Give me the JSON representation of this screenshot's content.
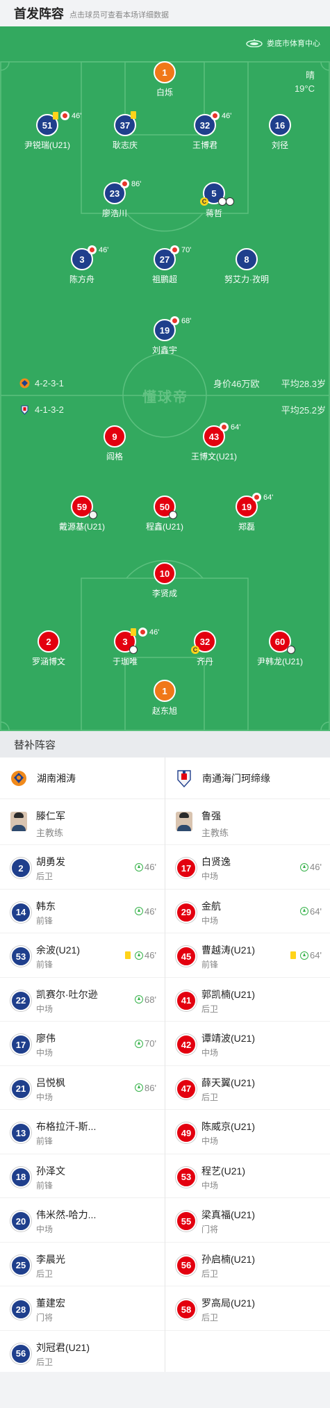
{
  "header": {
    "title": "首发阵容",
    "subtitle": "点击球员可查看本场详细数据"
  },
  "stadium": {
    "name": "娄底市体育中心",
    "icon": "stadium-icon"
  },
  "weather": {
    "condition": "晴",
    "temp": "19°C"
  },
  "watermark": "懂球帝",
  "home_formation": {
    "formation": "4-2-3-1",
    "value": "身价46万欧",
    "avg_age": "平均28.3岁",
    "color": "#1f3f8c"
  },
  "away_formation": {
    "formation": "4-1-3-2",
    "avg_age": "平均25.2岁",
    "color": "#e3000f"
  },
  "home_players": [
    {
      "num": "1",
      "name": "白烁"
    },
    {
      "num": "51",
      "name": "尹锐瑞(U21)",
      "time": "46'"
    },
    {
      "num": "37",
      "name": "耿志庆"
    },
    {
      "num": "32",
      "name": "王博君",
      "time": "46'"
    },
    {
      "num": "16",
      "name": "刘径"
    },
    {
      "num": "23",
      "name": "廖浩川",
      "time": "86'"
    },
    {
      "num": "5",
      "name": "蒋哲",
      "cap": "C"
    },
    {
      "num": "3",
      "name": "陈方舟",
      "time": "46'"
    },
    {
      "num": "27",
      "name": "祖鹏超",
      "time": "70'"
    },
    {
      "num": "8",
      "name": "努艾力·孜明"
    },
    {
      "num": "19",
      "name": "刘鑫宇",
      "time": "68'"
    }
  ],
  "away_players": [
    {
      "num": "9",
      "name": "阎格"
    },
    {
      "num": "43",
      "name": "王博文(U21)",
      "time": "64'"
    },
    {
      "num": "59",
      "name": "戴源基(U21)"
    },
    {
      "num": "50",
      "name": "程鑫(U21)"
    },
    {
      "num": "19",
      "name": "郑磊",
      "time": "64'"
    },
    {
      "num": "10",
      "name": "李贤成"
    },
    {
      "num": "2",
      "name": "罗涵博文"
    },
    {
      "num": "3",
      "name": "于珈唯",
      "time": "46'"
    },
    {
      "num": "32",
      "name": "齐丹",
      "cap": "C"
    },
    {
      "num": "60",
      "name": "尹韩龙(U21)"
    },
    {
      "num": "1",
      "name": "赵东旭"
    }
  ],
  "bench": {
    "title": "替补阵容",
    "home_team": {
      "name": "湖南湘涛",
      "logo": "hunan-xiangtao-logo"
    },
    "away_team": {
      "name": "南通海门珂缔缘",
      "logo": "nantong-haimen-logo"
    },
    "home_coach": {
      "name": "滕仁军",
      "role": "主教练"
    },
    "away_coach": {
      "name": "鲁强",
      "role": "主教练"
    },
    "home": [
      {
        "num": "2",
        "name": "胡勇发",
        "pos": "后卫",
        "sub": "46'"
      },
      {
        "num": "14",
        "name": "韩东",
        "pos": "前锋",
        "sub": "46'"
      },
      {
        "num": "53",
        "name": "余波(U21)",
        "pos": "前锋",
        "sub": "46'",
        "yellow": true
      },
      {
        "num": "22",
        "name": "凯赛尔·吐尔逊",
        "pos": "中场",
        "sub": "68'"
      },
      {
        "num": "17",
        "name": "廖伟",
        "pos": "中场",
        "sub": "70'"
      },
      {
        "num": "21",
        "name": "吕悦枫",
        "pos": "中场",
        "sub": "86'"
      },
      {
        "num": "13",
        "name": "布格拉汗-斯...",
        "pos": "前锋"
      },
      {
        "num": "18",
        "name": "孙泽文",
        "pos": "前锋"
      },
      {
        "num": "20",
        "name": "伟米然-哈力...",
        "pos": "中场"
      },
      {
        "num": "25",
        "name": "李晨光",
        "pos": "后卫"
      },
      {
        "num": "28",
        "name": "董建宏",
        "pos": "门将"
      },
      {
        "num": "56",
        "name": "刘冠君(U21)",
        "pos": "后卫"
      }
    ],
    "away": [
      {
        "num": "17",
        "name": "白贤逸",
        "pos": "中场",
        "sub": "46'"
      },
      {
        "num": "29",
        "name": "金航",
        "pos": "中场",
        "sub": "64'"
      },
      {
        "num": "45",
        "name": "曹越涛(U21)",
        "pos": "前锋",
        "sub": "64'",
        "yellow": true
      },
      {
        "num": "41",
        "name": "郭凯楠(U21)",
        "pos": "后卫"
      },
      {
        "num": "42",
        "name": "谭靖波(U21)",
        "pos": "中场"
      },
      {
        "num": "47",
        "name": "薛天翼(U21)",
        "pos": "后卫"
      },
      {
        "num": "49",
        "name": "陈威京(U21)",
        "pos": "中场"
      },
      {
        "num": "53",
        "name": "程艺(U21)",
        "pos": "中场"
      },
      {
        "num": "55",
        "name": "梁真福(U21)",
        "pos": "门将"
      },
      {
        "num": "56",
        "name": "孙启楠(U21)",
        "pos": "后卫"
      },
      {
        "num": "58",
        "name": "罗高局(U21)",
        "pos": "后卫"
      }
    ]
  }
}
